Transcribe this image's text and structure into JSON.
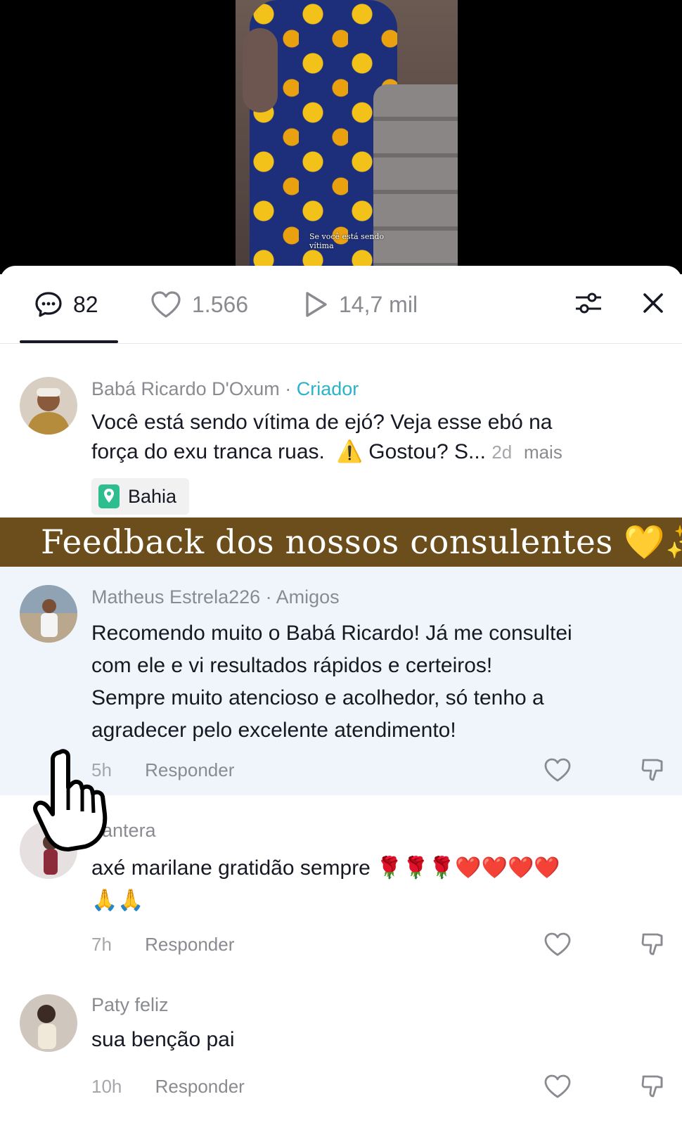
{
  "video": {
    "overlay_text_line1": "Se você está sendo",
    "overlay_text_line2": "vítima"
  },
  "stats": {
    "comments": "82",
    "likes": "1.566",
    "plays": "14,7 mil"
  },
  "caption": {
    "username": "Babá Ricardo D'Oxum",
    "separator": " · ",
    "badge": "Criador",
    "line1": "Você está sendo vítima de ejó? Veja esse ebó na",
    "line2": "força do exu tranca ruas.",
    "warning_emoji": "⚠️",
    "line2_tail": "Gostou? S...",
    "time": "2d",
    "more": "mais",
    "location": "Bahia"
  },
  "banner": {
    "text": "Feedback dos nossos consulentes 💛✨"
  },
  "comments": [
    {
      "username": "Matheus Estrela226",
      "tag": " · Amigos",
      "lines": [
        "Recomendo muito o Babá Ricardo! Já me consultei",
        "com ele e vi resultados rápidos e certeiros!",
        "Sempre muito atencioso e acolhedor, só tenho a",
        "agradecer pelo excelente atendimento!"
      ],
      "time": "5h",
      "reply": "Responder"
    },
    {
      "username": "pantera",
      "lines": [
        "axé marilane gratidão sempre 🌹🌹🌹❤️❤️❤️❤️",
        "🙏🙏"
      ],
      "time": "7h",
      "reply": "Responder"
    },
    {
      "username": "Paty feliz",
      "lines": [
        "sua benção pai"
      ],
      "time": "10h",
      "reply": "Responder"
    }
  ],
  "icons": {
    "comments": "comment-bubble-icon",
    "likes": "heart-icon",
    "plays": "play-icon",
    "filter": "sliders-icon",
    "close": "close-icon",
    "location": "location-pin-icon",
    "like_comment": "heart-outline-icon",
    "dislike_comment": "thumbs-down-icon",
    "cursor": "hand-pointer-icon"
  },
  "colors": {
    "creator_badge": "#2bb3c9",
    "banner_bg": "#6b4e1c",
    "highlight_bg": "#f0f5fc",
    "location_pin": "#2dbd8f"
  }
}
